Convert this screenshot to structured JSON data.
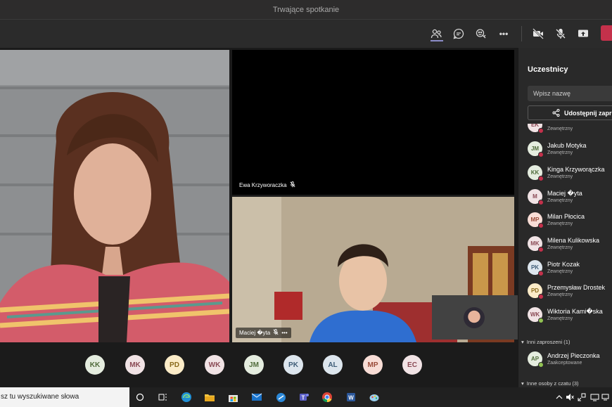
{
  "window": {
    "title": "Trwające spotkanie"
  },
  "toolbar": {
    "buttons": [
      {
        "name": "participants-icon"
      },
      {
        "name": "chat-icon"
      },
      {
        "name": "reactions-icon"
      },
      {
        "name": "more-icon",
        "label": "•••"
      },
      {
        "name": "camera-off-icon"
      },
      {
        "name": "mic-off-icon"
      },
      {
        "name": "share-screen-icon"
      },
      {
        "name": "leave-button"
      }
    ]
  },
  "stage": {
    "tiles": [
      {
        "name": "Ewa Krzyworaczka",
        "muted": true
      },
      {
        "name": "Maciej �yta",
        "muted": true,
        "more": "•••"
      }
    ]
  },
  "avatars": [
    {
      "initials": "KK",
      "bg": "#e5eddf",
      "fg": "#4f6b3a"
    },
    {
      "initials": "MK",
      "bg": "#f1e3e5",
      "fg": "#8a4a55"
    },
    {
      "initials": "PD",
      "bg": "#fcecc8",
      "fg": "#8a6a1b"
    },
    {
      "initials": "WK",
      "bg": "#f1e3e5",
      "fg": "#8a4a55"
    },
    {
      "initials": "JM",
      "bg": "#e5eddf",
      "fg": "#4f6b3a"
    },
    {
      "initials": "PK",
      "bg": "#dde6ee",
      "fg": "#3f5d78"
    },
    {
      "initials": "AL",
      "bg": "#dde6ee",
      "fg": "#3f5d78"
    },
    {
      "initials": "MP",
      "bg": "#f8ddd6",
      "fg": "#9a4b39"
    },
    {
      "initials": "EC",
      "bg": "#f1e3e5",
      "fg": "#8a4a55"
    }
  ],
  "panel": {
    "title": "Uczestnicy",
    "search_placeholder": "Wpisz nazwę",
    "share_label": "Udostępnij zapro",
    "participants": [
      {
        "initials": "EK",
        "name": "",
        "sub": "Zewnętrzny",
        "bg": "#f1e3e5",
        "fg": "#8a4a55",
        "status": "#c4314b"
      },
      {
        "initials": "JM",
        "name": "Jakub Motyka",
        "sub": "Zewnętrzny",
        "bg": "#e5eddf",
        "fg": "#4f6b3a",
        "status": "#c4314b"
      },
      {
        "initials": "KK",
        "name": "Kinga Krzyworączka",
        "sub": "Zewnętrzny",
        "bg": "#e5eddf",
        "fg": "#4f6b3a",
        "status": "#c4314b"
      },
      {
        "initials": "M",
        "name": "Maciej �yta",
        "sub": "Zewnętrzny",
        "bg": "#f1e3e5",
        "fg": "#8a4a55",
        "status": "#c4314b"
      },
      {
        "initials": "MP",
        "name": "Milan Płocica",
        "sub": "Zewnętrzny",
        "bg": "#f8ddd6",
        "fg": "#9a4b39",
        "status": "#c4314b"
      },
      {
        "initials": "MK",
        "name": "Milena Kulikowska",
        "sub": "Zewnętrzny",
        "bg": "#f1e3e5",
        "fg": "#8a4a55",
        "status": "#c4314b"
      },
      {
        "initials": "PK",
        "name": "Piotr Kozak",
        "sub": "Zewnętrzny",
        "bg": "#dde6ee",
        "fg": "#3f5d78",
        "status": "#c4314b"
      },
      {
        "initials": "PD",
        "name": "Przemysław Drostek",
        "sub": "Zewnętrzny",
        "bg": "#fcecc8",
        "fg": "#8a6a1b",
        "status": "#c4314b"
      },
      {
        "initials": "WK",
        "name": "Wiktoria Kami�ska",
        "sub": "Zewnętrzny",
        "bg": "#f1e3e5",
        "fg": "#8a4a55",
        "status": "#92c353"
      }
    ],
    "invited_header": "Inni zaproszeni (1)",
    "invited": [
      {
        "initials": "AP",
        "name": "Andrzej Pieczonka",
        "sub": "Zaakceptowane",
        "bg": "#e5eddf",
        "fg": "#4f6b3a",
        "status": "#92c353"
      }
    ],
    "chat_header": "Inne osoby z czatu (3)"
  },
  "taskbar": {
    "search_text": "sz tu wyszukiwane słowa",
    "apps": [
      "cortana-icon",
      "task-view-icon",
      "edge-icon",
      "file-explorer-icon",
      "store-icon",
      "mail-icon",
      "app-icon",
      "teams-icon",
      "chrome-icon",
      "word-icon",
      "paint-icon"
    ],
    "tray": [
      "chevron-up-icon",
      "speaker-icon",
      "notification-icon",
      "display-icon"
    ]
  }
}
